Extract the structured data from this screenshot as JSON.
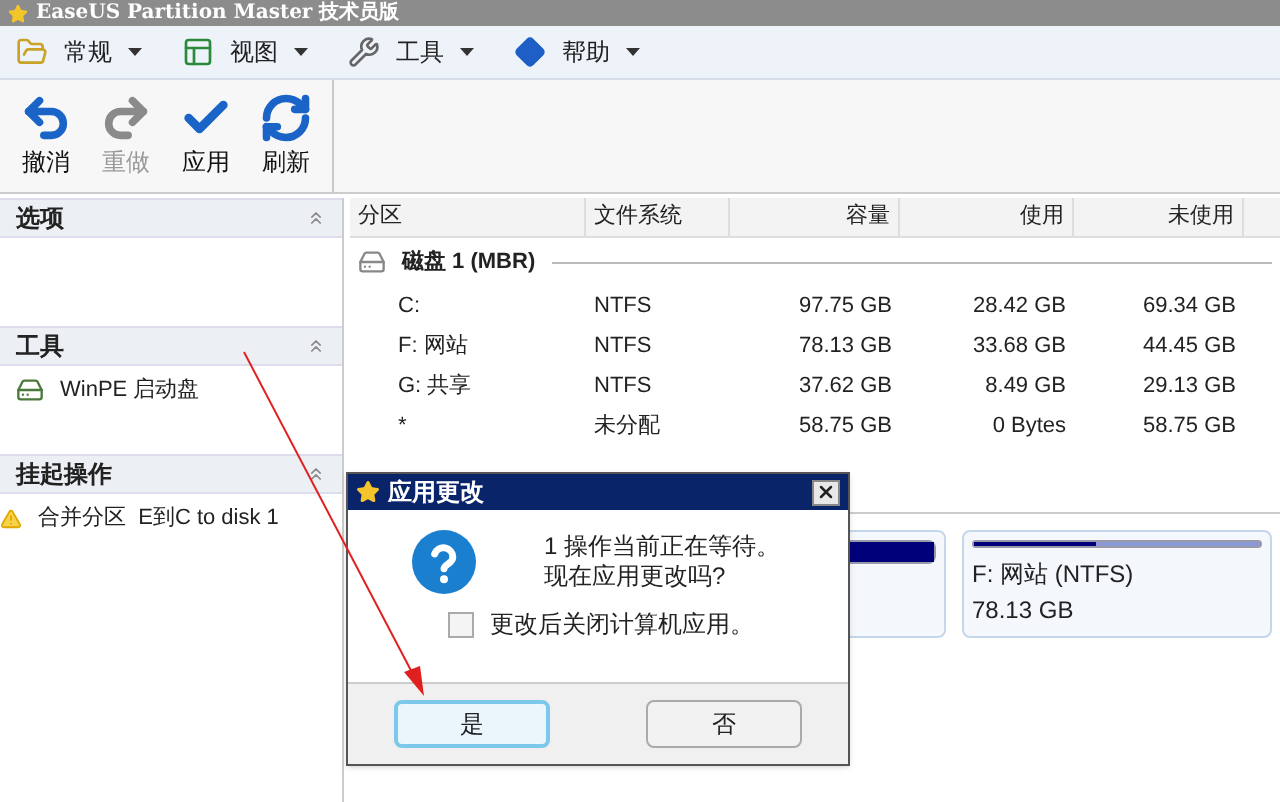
{
  "window": {
    "title": "EaseUS Partition Master 技术员版"
  },
  "menus": [
    {
      "label": "常规",
      "kind": "general"
    },
    {
      "label": "视图",
      "kind": "view"
    },
    {
      "label": "工具",
      "kind": "tools"
    },
    {
      "label": "帮助",
      "kind": "help"
    }
  ],
  "toolbar": [
    {
      "label": "撤消",
      "kind": "undo",
      "disabled": false
    },
    {
      "label": "重做",
      "kind": "redo",
      "disabled": true
    },
    {
      "label": "应用",
      "kind": "apply",
      "disabled": false
    },
    {
      "label": "刷新",
      "kind": "refresh",
      "disabled": false
    }
  ],
  "sidebar": [
    {
      "title": "选项"
    },
    {
      "title": "工具",
      "items": [
        {
          "label": "WinPE 启动盘",
          "kind": "drive"
        }
      ]
    },
    {
      "title": "挂起操作",
      "items": [
        {
          "label": "合并分区  E到C to disk 1",
          "kind": "warning"
        }
      ]
    }
  ],
  "table": {
    "columns": [
      "分区",
      "文件系统",
      "容量",
      "使用",
      "未使用"
    ],
    "disk": "磁盘 1 (MBR)",
    "rows": [
      [
        "C:",
        "NTFS",
        "97.75 GB",
        "28.42 GB",
        "69.34 GB"
      ],
      [
        "F: 网站",
        "NTFS",
        "78.13 GB",
        "33.68 GB",
        "44.45 GB"
      ],
      [
        "G: 共享",
        "NTFS",
        "37.62 GB",
        "8.49 GB",
        "29.13 GB"
      ],
      [
        "*",
        "未分配",
        "58.75 GB",
        "0 Bytes",
        "58.75 GB"
      ]
    ]
  },
  "disk_map": [
    {
      "level": 1
    },
    {
      "name": "F: 网站 (NTFS)",
      "size": "78.13 GB",
      "level": 0.43
    }
  ],
  "dialog": {
    "title": "应用更改",
    "message": [
      "1 操作当前正在等待。",
      "现在应用更改吗?"
    ],
    "checkbox": {
      "label": "更改后关闭计算机应用。",
      "checked": false
    },
    "buttons": [
      {
        "label": "是",
        "selected": true
      },
      {
        "label": "否",
        "selected": false
      }
    ]
  }
}
